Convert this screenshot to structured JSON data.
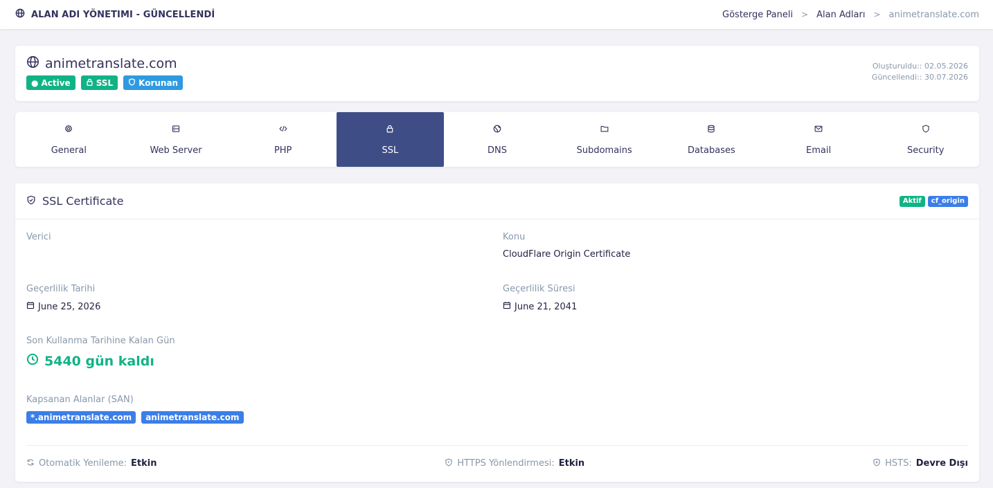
{
  "app": {
    "title": "ALAN ADI YÖNETIMI - GÜNCELLENDİ",
    "title_icon": "globe-icon"
  },
  "breadcrumb": {
    "items": [
      "Gösterge Paneli",
      "Alan Adları",
      "animetranslate.com"
    ]
  },
  "domain": {
    "name": "animetranslate.com",
    "badges": {
      "active": "Active",
      "ssl": "SSL",
      "protected": "Korunan"
    },
    "created": "Oluşturuldu:: 02.05.2026",
    "updated": "Güncellendi:: 30.07.2026"
  },
  "tabs": [
    {
      "label": "General",
      "icon": "gear-icon"
    },
    {
      "label": "Web Server",
      "icon": "server-icon"
    },
    {
      "label": "PHP",
      "icon": "code-icon"
    },
    {
      "label": "SSL",
      "icon": "lock-icon",
      "active": true
    },
    {
      "label": "DNS",
      "icon": "globe-icon"
    },
    {
      "label": "Subdomains",
      "icon": "folder-icon"
    },
    {
      "label": "Databases",
      "icon": "database-icon"
    },
    {
      "label": "Email",
      "icon": "mail-icon"
    },
    {
      "label": "Security",
      "icon": "shield-icon"
    }
  ],
  "ssl": {
    "title": "SSL Certificate",
    "status_badge": "Aktif",
    "type_badge": "cf_origin",
    "issuer_label": "Verici",
    "issuer_value": "",
    "subject_label": "Konu",
    "subject_value": "CloudFlare Origin Certificate",
    "valid_from_label": "Geçerlilik Tarihi",
    "valid_from_value": "June 25, 2026",
    "valid_to_label": "Geçerlilik Süresi",
    "valid_to_value": "June 21, 2041",
    "days_left_label": "Son Kullanma Tarihine Kalan Gün",
    "days_left_value": "5440 gün kaldı",
    "san_label": "Kapsanan Alanlar (SAN)",
    "san": [
      "*.animetranslate.com",
      "animetranslate.com"
    ],
    "auto_renew_label": "Otomatik Yenileme:",
    "auto_renew_value": "Etkin",
    "https_redirect_label": "HTTPS Yönlendirmesi:",
    "https_redirect_value": "Etkin",
    "hsts_label": "HSTS:",
    "hsts_value": "Devre Dışı"
  },
  "colors": {
    "accent": "#3f4d87",
    "success": "#11b385",
    "info": "#2f9ae0",
    "primary": "#3b7ee8"
  }
}
